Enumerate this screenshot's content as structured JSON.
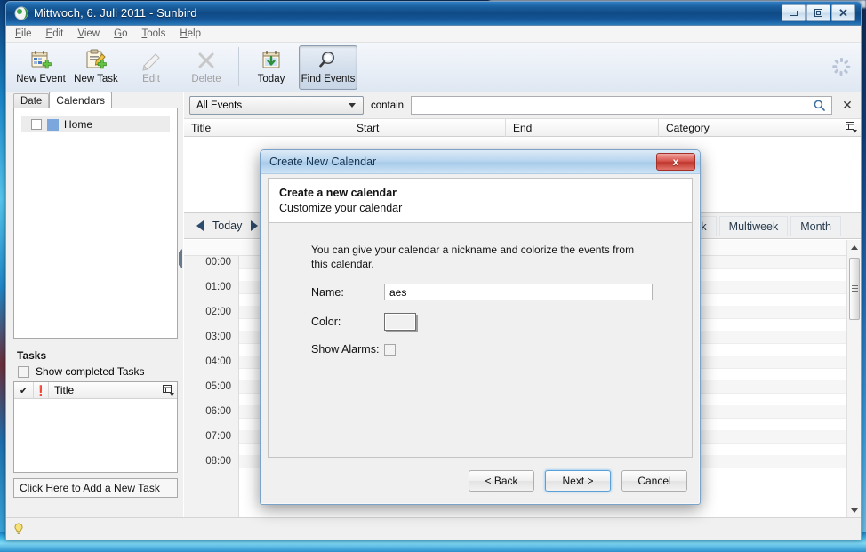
{
  "window": {
    "title": "Mittwoch, 6. Juli 2011 - Sunbird",
    "icon": "sunbird-icon",
    "buttons": {
      "minimize": "minimize",
      "maximize": "maximize",
      "close": "close"
    }
  },
  "menubar": {
    "items": [
      {
        "label": "File",
        "accel": "F"
      },
      {
        "label": "Edit",
        "accel": "E"
      },
      {
        "label": "View",
        "accel": "V"
      },
      {
        "label": "Go",
        "accel": "G"
      },
      {
        "label": "Tools",
        "accel": "T"
      },
      {
        "label": "Help",
        "accel": "H"
      }
    ]
  },
  "toolbar": {
    "items": [
      {
        "label": "New Event",
        "icon": "new-event-icon",
        "state": "enabled"
      },
      {
        "label": "New Task",
        "icon": "new-task-icon",
        "state": "enabled"
      },
      {
        "label": "Edit",
        "icon": "edit-icon",
        "state": "disabled"
      },
      {
        "label": "Delete",
        "icon": "delete-icon",
        "state": "disabled"
      },
      {
        "label": "Today",
        "icon": "today-icon",
        "state": "enabled"
      },
      {
        "label": "Find Events",
        "icon": "find-events-icon",
        "state": "pressed"
      }
    ]
  },
  "sidebar": {
    "tabs": [
      {
        "label": "Date",
        "active": false
      },
      {
        "label": "Calendars",
        "active": true
      }
    ],
    "calendars": [
      {
        "name": "Home",
        "checked": false,
        "color": "#7ba7dd"
      }
    ],
    "tasks": {
      "heading": "Tasks",
      "show_completed_label": "Show completed Tasks",
      "show_completed_checked": false,
      "columns": [
        "Title"
      ],
      "rows": [],
      "add_task_label": "Click Here to Add a New Task"
    }
  },
  "search": {
    "scope_selected": "All Events",
    "scope_options": [
      "All Events"
    ],
    "contain_label": "contain",
    "query_value": "",
    "query_placeholder": "",
    "search_icon": "magnifier-icon",
    "clear_icon": "close-x-icon"
  },
  "event_list": {
    "columns": [
      "Title",
      "Start",
      "End",
      "Category"
    ],
    "rows": []
  },
  "navigation": {
    "prev": "previous",
    "today_label": "Today",
    "next": "next",
    "views": [
      {
        "label": "Week",
        "truncated": "ek"
      },
      {
        "label": "Multiweek"
      },
      {
        "label": "Month"
      }
    ]
  },
  "day_grid": {
    "hours": [
      "00:00",
      "01:00",
      "02:00",
      "03:00",
      "04:00",
      "05:00",
      "06:00",
      "07:00",
      "08:00"
    ]
  },
  "statusbar": {
    "icon": "lightbulb-icon",
    "text": ""
  },
  "dialog": {
    "title": "Create New Calendar",
    "close_label": "x",
    "heading": "Create a new calendar",
    "subheading": "Customize your calendar",
    "description": "You can give your calendar a nickname and colorize the events from this calendar.",
    "fields": {
      "name_label": "Name:",
      "name_value": "aes",
      "color_label": "Color:",
      "color_value": "#f0f0f0",
      "alarms_label": "Show Alarms:",
      "alarms_checked": false
    },
    "buttons": {
      "back": "< Back",
      "next": "Next >",
      "cancel": "Cancel"
    }
  },
  "colors": {
    "titlebar_blue": "#0f4a85",
    "dialog_title": "#b9d6ef",
    "close_red": "#c0382f",
    "accent": "#5aa0d6"
  }
}
